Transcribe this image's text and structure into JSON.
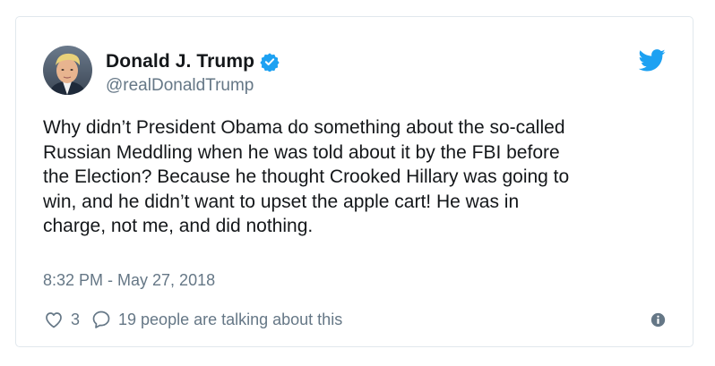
{
  "tweet": {
    "author": {
      "display_name": "Donald J. Trump",
      "handle": "@realDonaldTrump",
      "verified": true,
      "avatar_icon": "avatar-photo"
    },
    "text": "Why didn’t President Obama do something about the so-called\nRussian Meddling when he was told about it by the FBI before\nthe Election? Because he thought Crooked Hillary was going to\nwin, and he didn’t want to upset the apple cart! He was in\ncharge, not me, and did nothing.",
    "timestamp": "8:32 PM - May 27, 2018",
    "likes_count": "3",
    "talking_text": "19 people are talking about this"
  },
  "icons": {
    "logo": "twitter-bird-icon",
    "verified": "verified-badge-icon",
    "like": "heart-icon",
    "reply": "reply-bubble-icon",
    "info": "info-icon"
  },
  "colors": {
    "brand": "#1da1f2",
    "text": "#14171a",
    "secondary": "#657786",
    "border": "#e1e8ed"
  }
}
